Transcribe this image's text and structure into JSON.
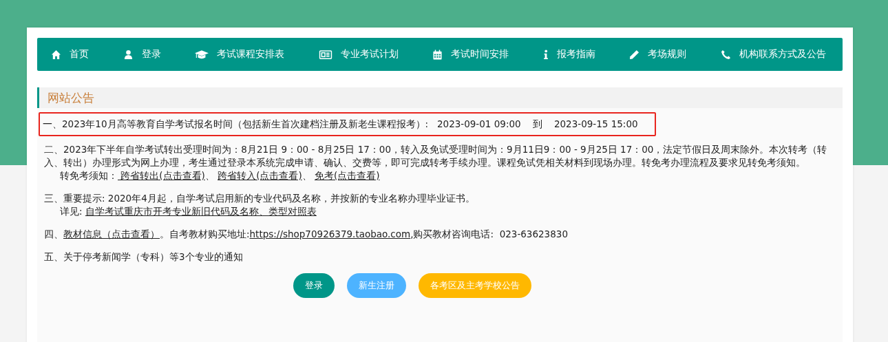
{
  "nav": [
    {
      "label": "首页"
    },
    {
      "label": "登录"
    },
    {
      "label": "考试课程安排表"
    },
    {
      "label": "专业考试计划"
    },
    {
      "label": "考试时间安排"
    },
    {
      "label": "报考指南"
    },
    {
      "label": "考场规则"
    },
    {
      "label": "机构联系方式及公告"
    }
  ],
  "section_title": "网站公告",
  "notices": [
    {
      "highlighted": true,
      "lines": [
        {
          "indent": false,
          "parts": [
            {
              "kind": "text",
              "text": "一、2023年10月高等教育自学考试报名时间（包括新生首次建档注册及新老生课程报考）:   2023-09-01 09:00    到    2023-09-15 15:00"
            }
          ]
        }
      ]
    },
    {
      "highlighted": false,
      "lines": [
        {
          "indent": false,
          "parts": [
            {
              "kind": "text",
              "text": "二、2023年下半年自学考试转出受理时间为：8月21日 9：00 - 8月25日 17：00，转入及免试受理时间为：9月11日9：00 - 9月25日 17：00，法定节假日及周末除外。本次转考（转入、转出）办理形式为网上办理，考生通过登录本系统完成申请、确认、交费等，即可完成转考手续办理。课程免试凭相关材料到现场办理。转免考办理流程及要求见转免考须知。"
            }
          ]
        },
        {
          "indent": true,
          "parts": [
            {
              "kind": "text",
              "text": "转免考须知："
            },
            {
              "kind": "link",
              "text": " 跨省转出(点击查看)"
            },
            {
              "kind": "text",
              "text": "、 "
            },
            {
              "kind": "link",
              "text": "跨省转入(点击查看)"
            },
            {
              "kind": "text",
              "text": "、 "
            },
            {
              "kind": "link",
              "text": "免考(点击查看)"
            }
          ]
        }
      ]
    },
    {
      "highlighted": false,
      "lines": [
        {
          "indent": false,
          "parts": [
            {
              "kind": "text",
              "text": "三、重要提示: 2020年4月起，自学考试启用新的专业代码及名称，并按新的专业名称办理毕业证书。"
            }
          ]
        },
        {
          "indent": true,
          "parts": [
            {
              "kind": "text",
              "text": "详见: "
            },
            {
              "kind": "link",
              "text": "自学考试重庆市开考专业新旧代码及名称、类型对照表"
            }
          ]
        }
      ]
    },
    {
      "highlighted": false,
      "lines": [
        {
          "indent": false,
          "parts": [
            {
              "kind": "text",
              "text": "四、"
            },
            {
              "kind": "link",
              "text": "教材信息（点击查看）"
            },
            {
              "kind": "text",
              "text": "。自考教材购买地址:"
            },
            {
              "kind": "link",
              "text": "https://shop70926379.taobao.com"
            },
            {
              "kind": "text",
              "text": ",购买教材咨询电话:  023-63623830"
            }
          ]
        }
      ]
    },
    {
      "highlighted": false,
      "lines": [
        {
          "indent": false,
          "parts": [
            {
              "kind": "text",
              "text": "五、关于停考新闻学（专科）等3个专业的通知"
            }
          ]
        }
      ]
    }
  ],
  "buttons": [
    {
      "label": "登录",
      "color": "#009688"
    },
    {
      "label": "新生注册",
      "color": "#4db3ff"
    },
    {
      "label": "各考区及主考学校公告",
      "color": "#ffb800"
    }
  ]
}
